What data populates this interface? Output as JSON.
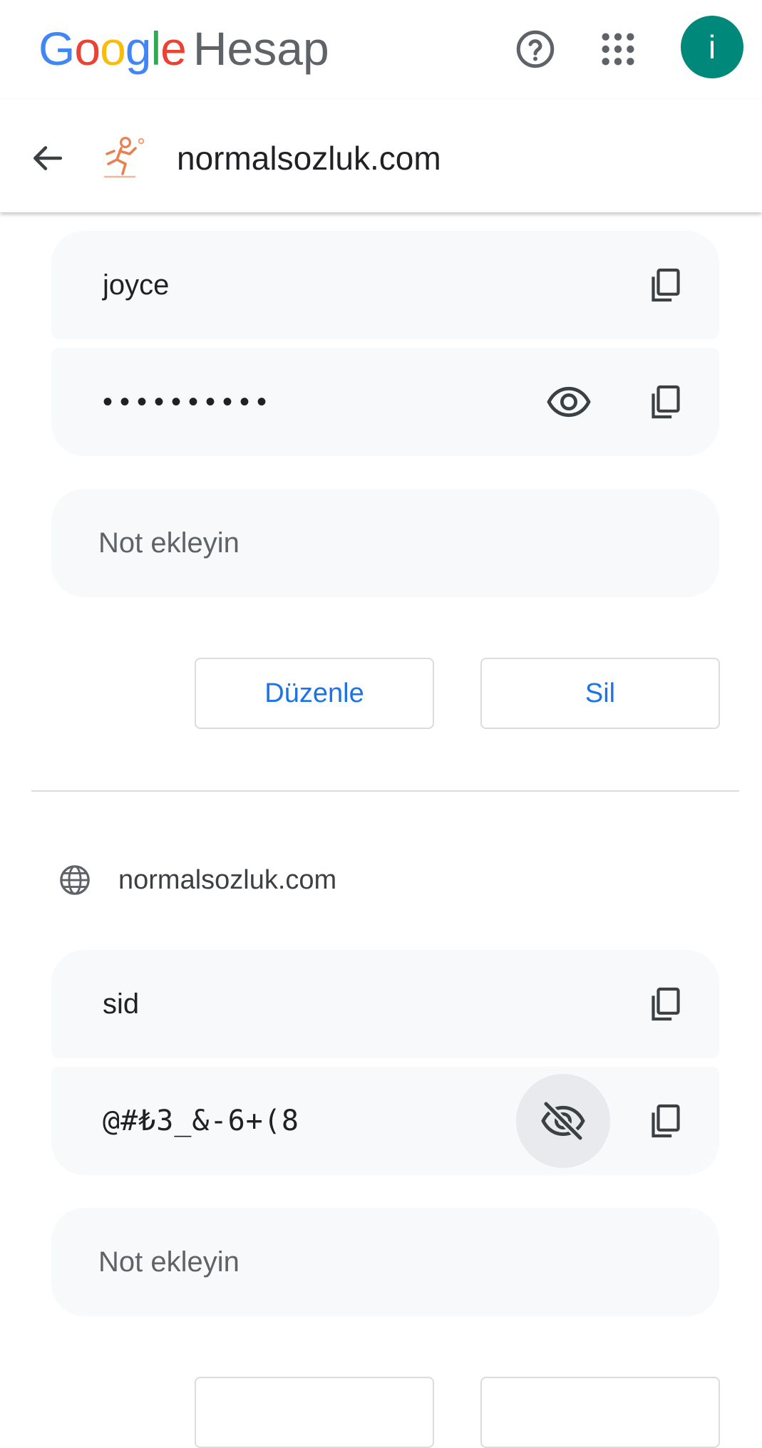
{
  "header": {
    "logo_letters": [
      "G",
      "o",
      "o",
      "g",
      "l",
      "e"
    ],
    "product": "Hesap",
    "avatar_initial": "i"
  },
  "subheader": {
    "title": "normalsozluk.com"
  },
  "entries": [
    {
      "username": "joyce",
      "password_masked": "••••••••••",
      "note_placeholder": "Not ekleyin",
      "edit_label": "Düzenle",
      "delete_label": "Sil"
    },
    {
      "site": "normalsozluk.com",
      "username": "sid",
      "password": "@#₺3_&-6+(8",
      "note_placeholder": "Not ekleyin"
    }
  ],
  "icons": {
    "help": "help-circle-icon",
    "apps": "apps-grid-icon",
    "back": "arrow-back-icon",
    "copy": "copy-icon",
    "visibility": "eye-icon",
    "visibility_off": "eye-off-icon",
    "globe": "globe-icon"
  },
  "colors": {
    "avatar": "#00897B",
    "card_bg": "#f8f9fa",
    "button_text": "#1a73e8",
    "google_blue": "#4285F4",
    "google_red": "#EA4335",
    "google_yellow": "#FBBC05",
    "google_green": "#34A853"
  }
}
